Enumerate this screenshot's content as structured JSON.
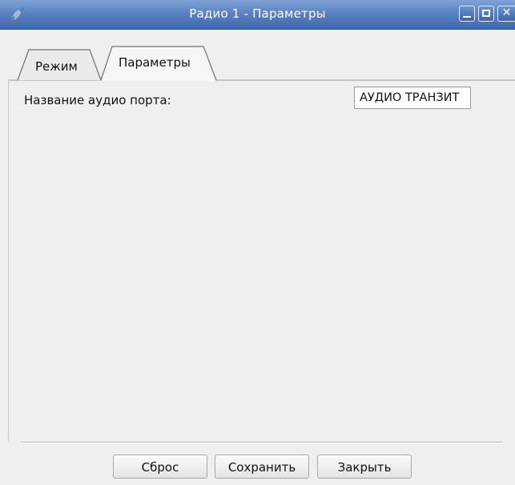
{
  "window": {
    "title": "Радио 1 - Параметры",
    "app_icon": "plug-icon",
    "controls": [
      "minimize-icon",
      "maximize-icon",
      "close-icon"
    ]
  },
  "tabs": [
    {
      "label": "Режим",
      "active": false
    },
    {
      "label": "Параметры",
      "active": true
    }
  ],
  "params": {
    "audio_port_label": "Название аудио порта:",
    "audio_port_value": "АУДИО ТРАНЗИТ"
  },
  "buttons": {
    "reset": "Сброс",
    "save": "Сохранить",
    "close": "Закрыть"
  },
  "colors": {
    "titlebar": "#4f77bb",
    "background": "#efefef"
  }
}
